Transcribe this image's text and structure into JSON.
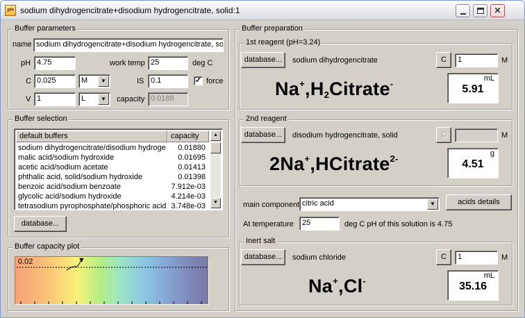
{
  "window": {
    "icon_text": "pH",
    "title": "sodium dihydrogencitrate+disodium hydrogencitrate, solid:1",
    "close_glyph": "✕"
  },
  "buffer_parameters": {
    "group_label": "Buffer parameters",
    "name_label": "name",
    "name_value": "sodium dihydrogencitrate+disodium hydrogencitrate, solic",
    "ph_label": "pH",
    "ph_value": "4.75",
    "work_temp_label": "work temp",
    "work_temp_value": "25",
    "work_temp_unit": "deg C",
    "c_label": "C",
    "c_value": "0.025",
    "c_unit": "M",
    "is_label": "IS",
    "is_value": "0.1",
    "force_label": "force",
    "force_checked": true,
    "check_glyph": "✓",
    "v_label": "V",
    "v_value": "1",
    "v_unit": "L",
    "capacity_label": "capacity",
    "capacity_value": "0.0188"
  },
  "buffer_selection": {
    "group_label": "Buffer selection",
    "columns": [
      "default buffers",
      "capacity"
    ],
    "rows": [
      {
        "name": "sodium dihydrogencitrate/disodium hydroge...",
        "capacity": "0.01880"
      },
      {
        "name": "malic acid/sodium hydroxide",
        "capacity": "0.01695"
      },
      {
        "name": "acetic acid/sodium acetate",
        "capacity": "0.01413"
      },
      {
        "name": "phthalic acid, solid/sodium hydroxide",
        "capacity": "0.01398"
      },
      {
        "name": "benzoic acid/sodium benzoate",
        "capacity": "7.912e-03"
      },
      {
        "name": "glycolic acid/sodium hydroxide",
        "capacity": "4.214e-03"
      },
      {
        "name": "tetrasodium pyrophosphate/phosphoric acid",
        "capacity": "3.748e-03"
      }
    ],
    "scroll_up": "▲",
    "scroll_down": "▼",
    "database_button": "database..."
  },
  "buffer_capacity_plot": {
    "group_label": "Buffer capacity plot",
    "max_label": "0.02",
    "marker_glyph": "▼",
    "marker_fraction": 0.34
  },
  "buffer_preparation": {
    "group_label": "Buffer preparation",
    "reagent1": {
      "label": "1st reagent (pH=3.24)",
      "database_button": "database...",
      "name": "sodium dihydrogencitrate",
      "conc_button": "C",
      "conc_value": "1",
      "conc_unit": "M",
      "formula_parts": [
        "Na",
        "+",
        ",H",
        "2",
        "Citrate",
        "-"
      ],
      "amount_unit": "mL",
      "amount_value": "5.91"
    },
    "reagent2": {
      "label": "2nd reagent",
      "database_button": "database...",
      "name": "disodium hydrogencitrate, solid",
      "conc_button": "C",
      "conc_value": "",
      "conc_unit": "M",
      "formula_parts": [
        "2Na",
        "+",
        ",HCitrate",
        "2-"
      ],
      "amount_unit": "g",
      "amount_value": "4.51"
    },
    "main_component_label": "main component",
    "main_component_value": "citric acid",
    "acids_details_button": "acids details",
    "at_temperature_label": "At temperature",
    "at_temperature_value": "25",
    "ph_note": "deg C pH of this solution is 4.75",
    "inert_salt": {
      "label": "Inert salt",
      "database_button": "database...",
      "name": "sodium chloride",
      "conc_button": "C",
      "conc_value": "1",
      "conc_unit": "M",
      "formula_parts": [
        "Na",
        "+",
        ",Cl",
        "-"
      ],
      "amount_unit": "mL",
      "amount_value": "35.16"
    }
  }
}
